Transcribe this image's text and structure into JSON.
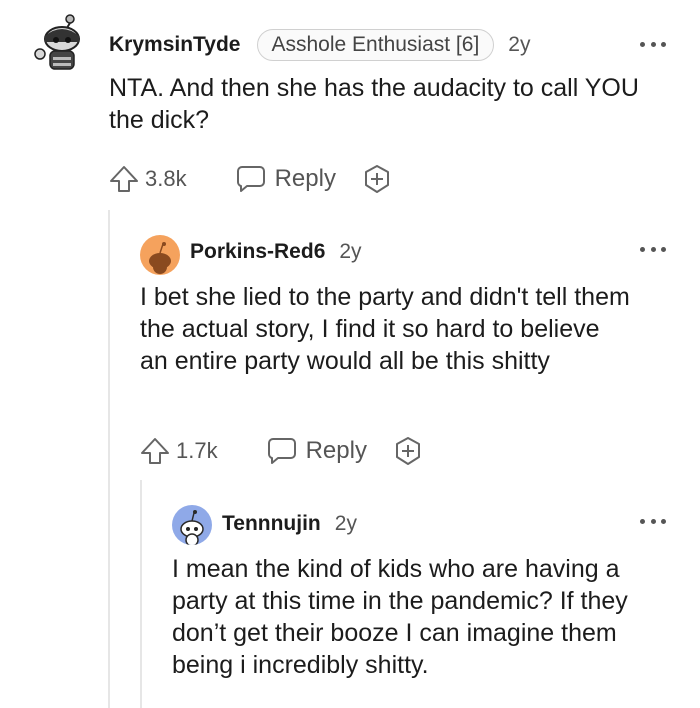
{
  "comments": [
    {
      "username": "KrymsinTyde",
      "flair": "Asshole Enthusiast [6]",
      "age": "2y",
      "body": "NTA. And then she has the audacity to call YOU the dick?",
      "score": "3.8k",
      "reply_label": "Reply",
      "avatar_icon": "snoo-avatar-icon"
    },
    {
      "username": "Porkins-Red6",
      "age": "2y",
      "body": "I bet she lied to the party and didn't tell them the actual story, I find it so hard to believe an entire party would all be this shitty",
      "score": "1.7k",
      "reply_label": "Reply",
      "avatar_icon": "snoo-avatar-icon",
      "avatar_color": "#f5a25d"
    },
    {
      "username": "Tennnujin",
      "age": "2y",
      "body": "I mean the kind of kids who are having a party at this time in the pandemic? If they don’t get their booze I can imagine them being i incredibly shitty.",
      "avatar_icon": "snoo-avatar-icon",
      "avatar_color": "#8fa9e8"
    }
  ],
  "colors": {
    "text": "#1c1c1c",
    "meta": "#555555",
    "thread_line": "#e6e6e6"
  }
}
